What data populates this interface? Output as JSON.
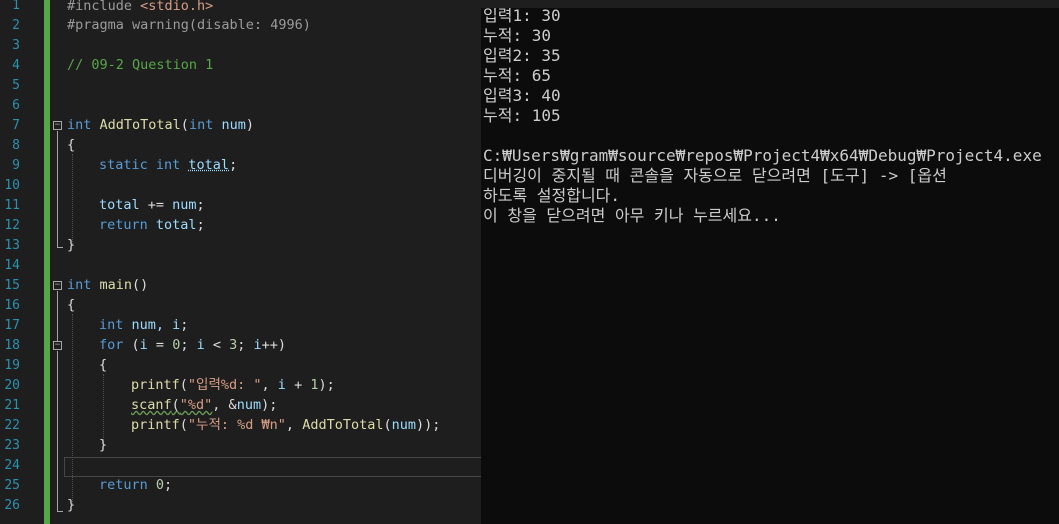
{
  "editor": {
    "line_numbers": [
      "1",
      "2",
      "3",
      "4",
      "5",
      "6",
      "7",
      "8",
      "9",
      "10",
      "11",
      "12",
      "13",
      "14",
      "15",
      "16",
      "17",
      "18",
      "19",
      "20",
      "21",
      "22",
      "23",
      "24",
      "25",
      "26"
    ],
    "code": {
      "l1_a": "#include ",
      "l1_b": "<stdio.h>",
      "l2_a": "#pragma warning(disable: 4996)",
      "l4": "// 09-2 Question 1",
      "l7_kw": "int",
      "l7_fn": " AddToTotal",
      "l7_p": "(",
      "l7_kw2": "int",
      "l7_var": " num",
      "l7_e": ")",
      "l8": "{",
      "l9_kw": "static int",
      "l9_var": "total",
      "l9_e": ";",
      "l11_var": "total",
      "l11_op": " += ",
      "l11_var2": "num",
      "l11_e": ";",
      "l12_kw": "return",
      "l12_var": "total",
      "l12_e": ";",
      "l13": "}",
      "l15_kw": "int",
      "l15_fn": " main",
      "l15_e": "()",
      "l16": "{",
      "l17_kw": "int",
      "l17_var": " num, i",
      "l17_e": ";",
      "l18_kw": "for",
      "l18_a": " (",
      "l18_var": "i",
      "l18_b": " = ",
      "l18_n": "0",
      "l18_c": "; ",
      "l18_var2": "i",
      "l18_d": " < ",
      "l18_n2": "3",
      "l18_e": "; ",
      "l18_var3": "i",
      "l18_f": "++)",
      "l19": "{",
      "l20_fn": "printf",
      "l20_a": "(",
      "l20_s": "\"입력%d: \"",
      "l20_b": ", ",
      "l20_var": "i",
      "l20_c": " + ",
      "l20_n": "1",
      "l20_d": ");",
      "l21_fn": "scanf",
      "l21_a": "(",
      "l21_s": "\"%d\"",
      "l21_b": ", &",
      "l21_var": "num",
      "l21_c": ");",
      "l22_fn": "printf",
      "l22_a": "(",
      "l22_s": "\"누적: %d ₩n\"",
      "l22_b": ", ",
      "l22_fn2": "AddToTotal",
      "l22_c": "(",
      "l22_var": "num",
      "l22_d": "));",
      "l23": "}",
      "l25_kw": "return",
      "l25_n": " 0",
      "l25_e": ";",
      "l26": "}"
    }
  },
  "console": {
    "lines": [
      "입력1: 30",
      "누적: 30",
      "입력2: 35",
      "누적: 65",
      "입력3: 40",
      "누적: 105",
      "",
      "C:₩Users₩gram₩source₩repos₩Project4₩x64₩Debug₩Project4.exe",
      "디버깅이 중지될 때 콘솔을 자동으로 닫으려면 [도구] -> [옵션",
      "하도록 설정합니다.",
      "이 창을 닫으려면 아무 키나 누르세요..."
    ]
  },
  "colors": {
    "editor_bg": "#1e1e1e",
    "console_bg": "#0c0c0c",
    "keyword": "#569cd6",
    "string": "#d69d85",
    "comment": "#57a64a",
    "line_number": "#2b91af"
  }
}
